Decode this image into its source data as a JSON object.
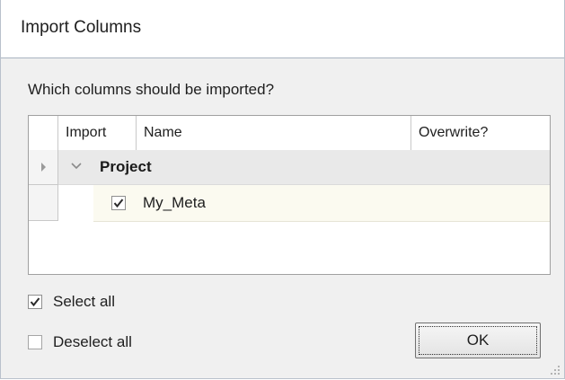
{
  "dialog": {
    "title": "Import Columns",
    "prompt": "Which columns should be imported?"
  },
  "grid": {
    "columns": [
      "Import",
      "Name",
      "Overwrite?"
    ],
    "group": {
      "label": "Project",
      "expanded": true
    },
    "rows": [
      {
        "import": true,
        "name": "My_Meta",
        "overwrite": ""
      }
    ]
  },
  "options": {
    "select_all": {
      "label": "Select all",
      "checked": true
    },
    "deselect_all": {
      "label": "Deselect all",
      "checked": false
    }
  },
  "buttons": {
    "ok": "OK"
  }
}
